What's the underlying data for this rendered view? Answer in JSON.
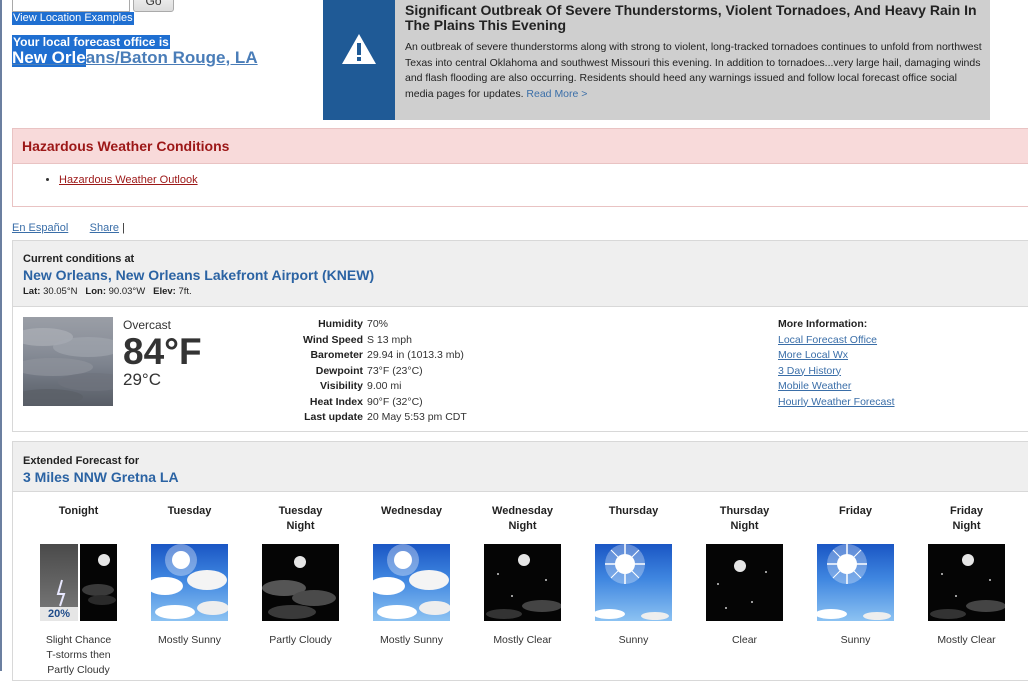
{
  "top": {
    "go_label": "Go",
    "location_examples": "View Location Examples",
    "office_label": "Your local forecast office is",
    "office_name_selected": "New Orle",
    "office_name_rest": "ans/Baton Rouge, LA"
  },
  "alert": {
    "icon": "warning-triangle-icon",
    "title": "Significant Outbreak Of Severe Thunderstorms, Violent Tornadoes, And Heavy Rain In The Plains This Evening",
    "body": "An outbreak of severe thunderstorms along with strong to violent, long-tracked tornadoes continues to unfold from northwest Texas into central Oklahoma and southwest Missouri this evening. In addition to tornadoes...very large hail, damaging winds and flash flooding are also occurring. Residents should heed any warnings issued and follow local forecast office social media pages for updates.",
    "read_more": "Read More >"
  },
  "hazards": {
    "title": "Hazardous Weather Conditions",
    "items": [
      "Hazardous Weather Outlook"
    ]
  },
  "links": {
    "espanol": "En Español",
    "share": "Share",
    "sep": "|"
  },
  "current": {
    "label": "Current conditions at",
    "station": "New Orleans, New Orleans Lakefront Airport (KNEW)",
    "lat_label": "Lat:",
    "lat": "30.05°N",
    "lon_label": "Lon:",
    "lon": "90.03°W",
    "elev_label": "Elev:",
    "elev": "7ft.",
    "description": "Overcast",
    "temp_f": "84°F",
    "temp_c": "29°C",
    "details": [
      {
        "key": "Humidity",
        "value": "70%"
      },
      {
        "key": "Wind Speed",
        "value": "S 13 mph"
      },
      {
        "key": "Barometer",
        "value": "29.94 in (1013.3 mb)"
      },
      {
        "key": "Dewpoint",
        "value": "73°F (23°C)"
      },
      {
        "key": "Visibility",
        "value": "9.00 mi"
      },
      {
        "key": "Heat Index",
        "value": "90°F (32°C)"
      },
      {
        "key": "Last update",
        "value": "20 May 5:53 pm CDT"
      }
    ],
    "more_info_title": "More Information:",
    "more_info_links": [
      "Local Forecast Office",
      "More Local Wx",
      "3 Day History",
      "Mobile Weather",
      "Hourly Weather Forecast"
    ]
  },
  "extended": {
    "label": "Extended Forecast for",
    "location": "3 Miles NNW Gretna LA",
    "periods": [
      {
        "name_line1": "Tonight",
        "name_line2": "",
        "icon": "tstorm-night-icon",
        "pop": "20%",
        "desc": [
          "Slight Chance",
          "T-storms then",
          "Partly Cloudy"
        ]
      },
      {
        "name_line1": "Tuesday",
        "name_line2": "",
        "icon": "mostly-sunny-icon",
        "pop": "",
        "desc": [
          "Mostly Sunny"
        ]
      },
      {
        "name_line1": "Tuesday",
        "name_line2": "Night",
        "icon": "partly-cloudy-night-icon",
        "pop": "",
        "desc": [
          "Partly Cloudy"
        ]
      },
      {
        "name_line1": "Wednesday",
        "name_line2": "",
        "icon": "mostly-sunny-icon",
        "pop": "",
        "desc": [
          "Mostly Sunny"
        ]
      },
      {
        "name_line1": "Wednesday",
        "name_line2": "Night",
        "icon": "mostly-clear-night-icon",
        "pop": "",
        "desc": [
          "Mostly Clear"
        ]
      },
      {
        "name_line1": "Thursday",
        "name_line2": "",
        "icon": "sunny-icon",
        "pop": "",
        "desc": [
          "Sunny"
        ]
      },
      {
        "name_line1": "Thursday",
        "name_line2": "Night",
        "icon": "clear-night-icon",
        "pop": "",
        "desc": [
          "Clear"
        ]
      },
      {
        "name_line1": "Friday",
        "name_line2": "",
        "icon": "sunny-icon",
        "pop": "",
        "desc": [
          "Sunny"
        ]
      },
      {
        "name_line1": "Friday",
        "name_line2": "Night",
        "icon": "mostly-clear-night-icon",
        "pop": "",
        "desc": [
          "Mostly Clear"
        ]
      }
    ]
  }
}
